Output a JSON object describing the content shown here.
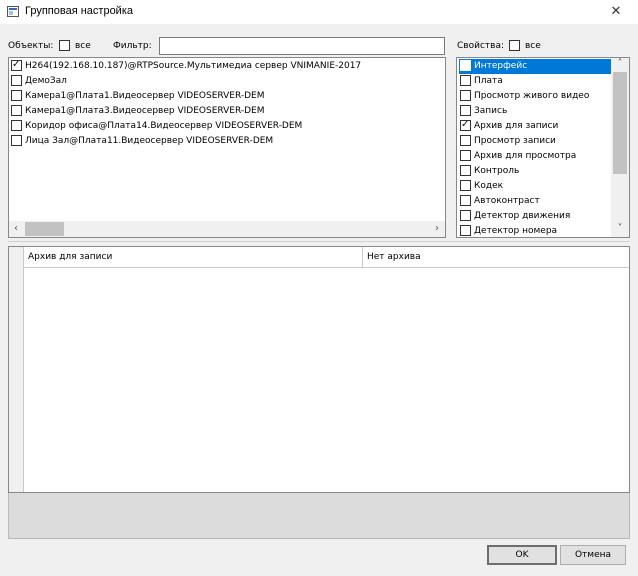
{
  "window": {
    "title": "Групповая настройка",
    "close_glyph": "✕"
  },
  "objects": {
    "label": "Объекты:",
    "all_label": "все",
    "all_checked": false,
    "filter_label": "Фильтр:",
    "filter_value": "",
    "items": [
      {
        "label": "H264(192.168.10.187)@RTPSource.Мультимедиа сервер VNIMANIE-2017",
        "checked": true
      },
      {
        "label": "ДемоЗал",
        "checked": false
      },
      {
        "label": "Камера1@Плата1.Видеосервер VIDEOSERVER-DEM",
        "checked": false
      },
      {
        "label": "Камера1@Плата3.Видеосервер VIDEOSERVER-DEM",
        "checked": false
      },
      {
        "label": "Коридор офиса@Плата14.Видеосервер VIDEOSERVER-DEM",
        "checked": false
      },
      {
        "label": "Лица Зал@Плата11.Видеосервер VIDEOSERVER-DEM",
        "checked": false
      }
    ]
  },
  "properties": {
    "label": "Свойства:",
    "all_label": "все",
    "all_checked": false,
    "items": [
      {
        "label": "Интерфейс",
        "checked": false,
        "selected": true
      },
      {
        "label": "Плата",
        "checked": false,
        "selected": false
      },
      {
        "label": "Просмотр живого видео",
        "checked": false,
        "selected": false
      },
      {
        "label": "Запись",
        "checked": false,
        "selected": false
      },
      {
        "label": "Архив для записи",
        "checked": true,
        "selected": false
      },
      {
        "label": "Просмотр записи",
        "checked": false,
        "selected": false
      },
      {
        "label": "Архив для просмотра",
        "checked": false,
        "selected": false
      },
      {
        "label": "Контроль",
        "checked": false,
        "selected": false
      },
      {
        "label": "Кодек",
        "checked": false,
        "selected": false
      },
      {
        "label": "Автоконтраст",
        "checked": false,
        "selected": false
      },
      {
        "label": "Детектор движения",
        "checked": false,
        "selected": false
      },
      {
        "label": "Детектор номера",
        "checked": false,
        "selected": false
      }
    ]
  },
  "grid": {
    "columns": [
      "Архив для записи",
      "Нет архива"
    ]
  },
  "buttons": {
    "ok": "OK",
    "cancel": "Отмена"
  },
  "icons": {
    "scroll_left": "‹",
    "scroll_right": "›",
    "scroll_up": "˄",
    "scroll_down": "˅"
  }
}
